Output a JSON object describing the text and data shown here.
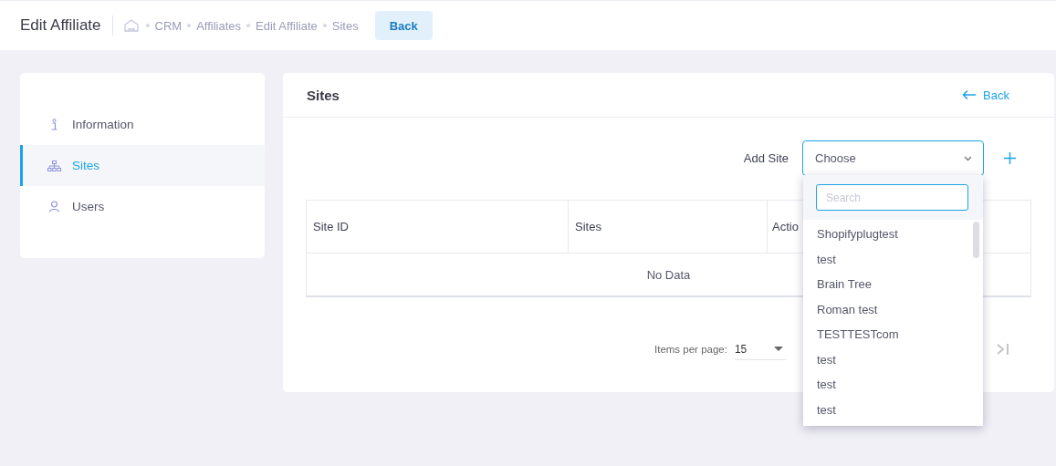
{
  "header": {
    "title": "Edit Affiliate",
    "breadcrumbs": [
      "CRM",
      "Affiliates",
      "Edit Affiliate",
      "Sites"
    ],
    "back_button": "Back"
  },
  "sidebar": {
    "items": [
      {
        "label": "Information",
        "kind": "info",
        "selected": false
      },
      {
        "label": "Sites",
        "kind": "sitemap",
        "selected": true
      },
      {
        "label": "Users",
        "kind": "user",
        "selected": false
      }
    ]
  },
  "panel": {
    "title": "Sites",
    "back_link": "Back",
    "add_site": {
      "label": "Add Site",
      "placeholder": "Choose",
      "expanded": true,
      "search_placeholder": "Search",
      "options": [
        "Shopifyplugtest",
        "test",
        "Brain Tree",
        "Roman test",
        "TESTTESTcom",
        "test",
        "test",
        "test"
      ]
    },
    "table": {
      "columns": [
        "Site ID",
        "Sites",
        "Actio"
      ],
      "empty_text": "No Data"
    },
    "pagination": {
      "label": "Items per page:",
      "per_page": "15"
    }
  }
}
